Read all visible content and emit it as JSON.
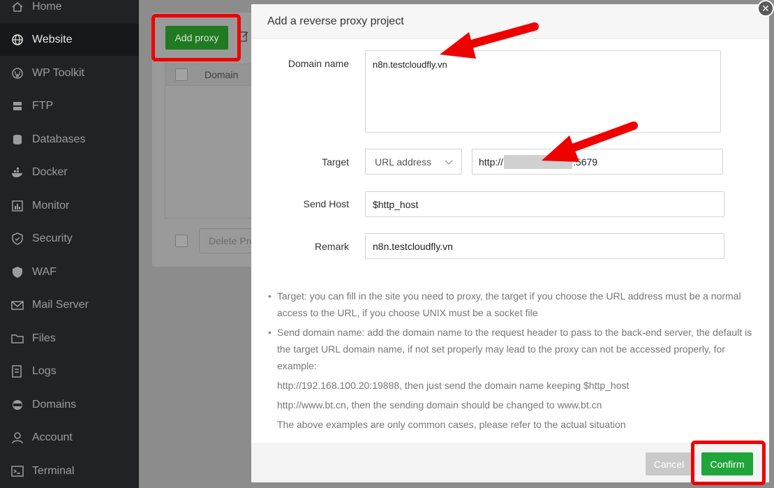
{
  "sidebar": {
    "items": [
      {
        "label": "Home",
        "icon": "home-icon"
      },
      {
        "label": "Website",
        "icon": "globe-icon"
      },
      {
        "label": "WP Toolkit",
        "icon": "wordpress-icon"
      },
      {
        "label": "FTP",
        "icon": "ftp-icon"
      },
      {
        "label": "Databases",
        "icon": "database-icon"
      },
      {
        "label": "Docker",
        "icon": "docker-icon"
      },
      {
        "label": "Monitor",
        "icon": "monitor-icon"
      },
      {
        "label": "Security",
        "icon": "shield-icon"
      },
      {
        "label": "WAF",
        "icon": "waf-shield-icon"
      },
      {
        "label": "Mail Server",
        "icon": "mail-icon"
      },
      {
        "label": "Files",
        "icon": "folder-icon"
      },
      {
        "label": "Logs",
        "icon": "logs-icon"
      },
      {
        "label": "Domains",
        "icon": "domains-icon"
      },
      {
        "label": "Account",
        "icon": "user-icon"
      },
      {
        "label": "Terminal",
        "icon": "terminal-icon"
      }
    ],
    "active": "Website"
  },
  "background": {
    "add_proxy_label": "Add proxy",
    "domain_column": "Domain",
    "delete_label": "Delete Pro"
  },
  "modal": {
    "title": "Add a reverse proxy project",
    "domain_label": "Domain name",
    "domain_value": "n8n.testcloudfly.vn",
    "target_label": "Target",
    "target_type": "URL address",
    "target_prefix": "http://",
    "target_suffix": ":5679",
    "send_host_label": "Send Host",
    "send_host_value": "$http_host",
    "remark_label": "Remark",
    "remark_value": "n8n.testcloudfly.vn",
    "help": {
      "bullet1": "Target: you can fill in the site you need to proxy, the target if you choose the URL address must be a normal access to the URL, if you choose UNIX must be a socket file",
      "bullet2": "Send domain name: add the domain name to the request header to pass to the back-end server, the default is the target URL domain name, if not set properly may lead to the proxy can not be accessed properly, for example:",
      "example1": "http://192.168.100.20:19888, then just send the domain name keeping $http_host",
      "example2": "http://www.bt.cn, then the sending domain should be changed to www.bt.cn",
      "note": "The above examples are only common cases, please refer to the actual situation"
    },
    "cancel_label": "Cancel",
    "confirm_label": "Confirm"
  },
  "colors": {
    "confirm_green": "#20a53a",
    "highlight_red": "#ee0000",
    "sidebar_bg": "#202226"
  }
}
